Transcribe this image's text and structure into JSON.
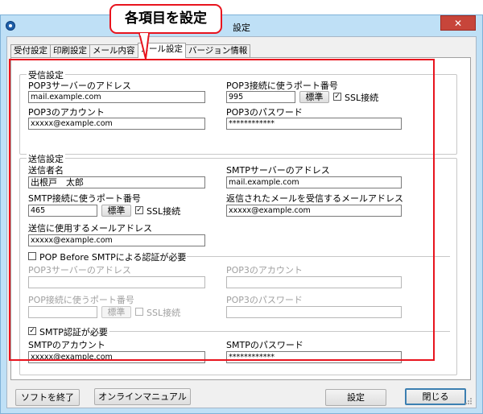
{
  "window": {
    "title": "設定",
    "close_glyph": "✕"
  },
  "tabs": [
    "受付設定",
    "印刷設定",
    "メール内容",
    "メール設定",
    "バージョン情報"
  ],
  "active_tab_index": 3,
  "receive": {
    "group_title": "受信設定",
    "server_label": "POP3サーバーのアドレス",
    "server_value": "mail.example.com",
    "port_label": "POP3接続に使うポート番号",
    "port_value": "995",
    "standard_button": "標準",
    "ssl_label": "SSL接続",
    "ssl_checked": true,
    "account_label": "POP3のアカウント",
    "account_value": "xxxxx@example.com",
    "password_label": "POP3のパスワード",
    "password_value": "************"
  },
  "send": {
    "group_title": "送信設定",
    "sender_label": "送信者名",
    "sender_value": "出根戸　太郎",
    "smtp_server_label": "SMTPサーバーのアドレス",
    "smtp_server_value": "mail.example.com",
    "smtp_port_label": "SMTP接続に使うポート番号",
    "smtp_port_value": "465",
    "standard_button": "標準",
    "ssl_label": "SSL接続",
    "ssl_checked": true,
    "reply_label": "返信されたメールを受信するメールアドレス",
    "reply_value": "xxxxx@example.com",
    "from_label": "送信に使用するメールアドレス",
    "from_value": "xxxxx@example.com",
    "pop_before_label": "POP Before SMTPによる認証が必要",
    "pop_before_checked": false,
    "pb_server_label": "POP3サーバーのアドレス",
    "pb_account_label": "POP3のアカウント",
    "pb_port_label": "POP接続に使うポート番号",
    "pb_password_label": "POP3のパスワード",
    "pb_standard_button": "標準",
    "pb_ssl_label": "SSL接続",
    "smtp_auth_label": "SMTP認証が必要",
    "smtp_auth_checked": true,
    "smtp_account_label": "SMTPのアカウント",
    "smtp_account_value": "xxxxx@example.com",
    "smtp_password_label": "SMTPのパスワード",
    "smtp_password_value": "************"
  },
  "footer": {
    "quit_button": "ソフトを終了",
    "manual_button": "オンラインマニュアル",
    "settings_button": "設定",
    "close_button": "閉じる"
  },
  "callout": {
    "text": "各項目を設定"
  },
  "colors": {
    "highlight": "#e8141e",
    "titlebar": "#bfe0f6"
  }
}
